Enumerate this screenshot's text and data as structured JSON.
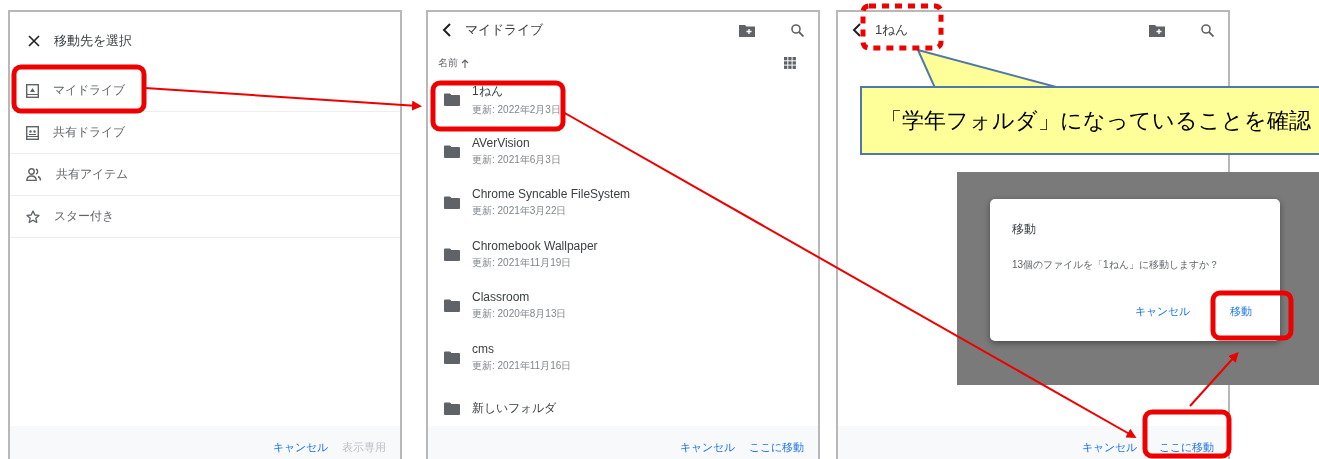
{
  "picker": {
    "title": "移動先を選択",
    "items": [
      "マイドライブ",
      "共有ドライブ",
      "共有アイテム",
      "スター付き"
    ],
    "footer": {
      "cancel": "キャンセル",
      "view_only": "表示専用"
    }
  },
  "folder_list": {
    "title": "マイドライブ",
    "sort_label": "名前",
    "folders": [
      {
        "name": "1ねん",
        "modified": "更新: 2022年2月3日"
      },
      {
        "name": "AVerVision",
        "modified": "更新: 2021年6月3日"
      },
      {
        "name": "Chrome Syncable FileSystem",
        "modified": "更新: 2021年3月22日"
      },
      {
        "name": "Chromebook Wallpaper",
        "modified": "更新: 2021年11月19日"
      },
      {
        "name": "Classroom",
        "modified": "更新: 2020年8月13日"
      },
      {
        "name": "cms",
        "modified": "更新: 2021年11月16日"
      },
      {
        "name": "新しいフォルダ"
      }
    ],
    "footer": {
      "cancel": "キャンセル",
      "move_here": "ここに移動"
    }
  },
  "target_folder": {
    "title": "1ねん",
    "footer": {
      "cancel": "キャンセル",
      "move_here": "ここに移動"
    }
  },
  "callout": {
    "text": "「学年フォルダ」になっていることを確認"
  },
  "dialog": {
    "title": "移動",
    "message": "13個のファイルを「1ねん」に移動しますか？",
    "cancel": "キャンセル",
    "confirm": "移動"
  }
}
